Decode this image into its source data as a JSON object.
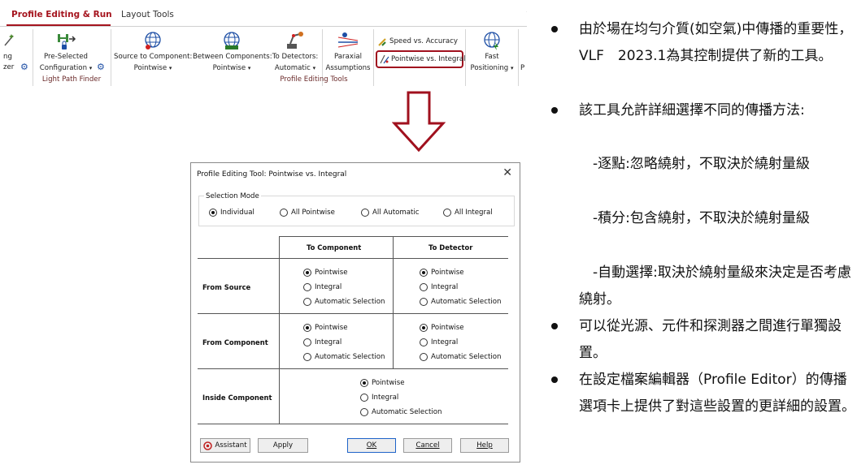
{
  "ribbon": {
    "tabs": [
      "Profile Editing & Run",
      "Layout Tools"
    ],
    "clip_labels": [
      "ng",
      "zer"
    ],
    "preselected_line1": "Pre-Selected",
    "preselected_line2": "Configuration",
    "light_path_finder": "Light Path Finder",
    "src_to_comp_line1": "Source to Component:",
    "src_to_comp_line2": "Pointwise",
    "between_comp_line1": "Between Components:",
    "between_comp_line2": "Pointwise",
    "to_detectors_line1": "To Detectors:",
    "to_detectors_line2": "Automatic",
    "paraxial_line1": "Paraxial",
    "paraxial_line2": "Assumptions",
    "speed_accuracy": "Speed vs. Accuracy",
    "pointwise_integral": "Pointwise vs. Integral",
    "fast_line1": "Fast",
    "fast_line2": "Positioning",
    "clip_right": "P",
    "profile_editing_tools": "Profile Editing Tools",
    "caret": "▾",
    "gear_glyph": "⚙"
  },
  "dialog": {
    "title": "Profile Editing Tool: Pointwise vs. Integral",
    "close_glyph": "✕",
    "selection_mode_label": "Selection Mode",
    "selection_modes": [
      "Individual",
      "All Pointwise",
      "All Automatic",
      "All Integral"
    ],
    "selected_mode": "Individual",
    "col_headers": [
      "To Component",
      "To Detector"
    ],
    "row_headers": [
      "From Source",
      "From Component",
      "Inside Component"
    ],
    "option_labels": [
      "Pointwise",
      "Integral",
      "Automatic Selection"
    ],
    "buttons": {
      "assistant": "Assistant",
      "apply": "Apply",
      "ok": "OK",
      "cancel": "Cancel",
      "help": "Help"
    }
  },
  "notes": [
    "由於場在均勻介質(如空氣)中傳播的重要性，VLF　2023.1為其控制提供了新的工具。",
    "該工具允許詳細選擇不同的傳播方法:",
    "　-逐點:忽略繞射，不取決於繞射量級",
    "　-積分:包含繞射，不取決於繞射量級",
    "　-自動選擇:取決於繞射量級來決定是否考慮繞射。",
    "可以從光源、元件和探測器之間進行單獨設置。",
    "在設定檔案編輯器（Profile Editor）的傳播選項卡上提供了對這些設置的更詳細的設置。"
  ],
  "colors": {
    "accent": "#a5141e",
    "highlight_border": "#a0101e",
    "arrow": "#a0101e",
    "gear": "#1e4fa5"
  }
}
